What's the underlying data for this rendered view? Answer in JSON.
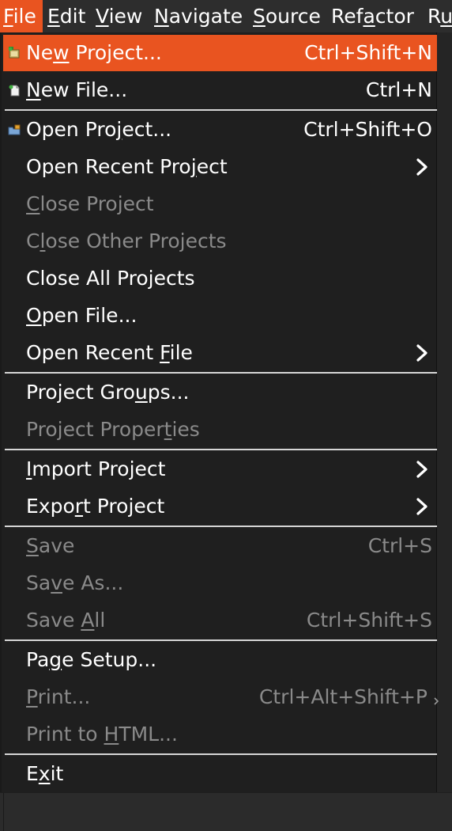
{
  "menubar": {
    "items": [
      {
        "label": "File",
        "mnemonic": 0,
        "active": true
      },
      {
        "label": "Edit",
        "mnemonic": 0
      },
      {
        "label": "View",
        "mnemonic": 0
      },
      {
        "label": "Navigate",
        "mnemonic": 0
      },
      {
        "label": "Source",
        "mnemonic": 0
      },
      {
        "label": "Refactor",
        "mnemonic": 3
      },
      {
        "label": "Ru",
        "mnemonic": 1
      }
    ]
  },
  "file_menu": {
    "items": [
      {
        "label": "New Project...",
        "mnemonic": 2,
        "shortcut": "Ctrl+Shift+N",
        "icon": "new-project-icon",
        "highlighted": true
      },
      {
        "label": "New File...",
        "mnemonic": 0,
        "shortcut": "Ctrl+N",
        "icon": "new-file-icon"
      },
      {
        "separator": true
      },
      {
        "label": "Open Project...",
        "mnemonic": 8,
        "shortcut": "Ctrl+Shift+O",
        "icon": "open-project-icon"
      },
      {
        "label": "Open Recent Project",
        "mnemonic": 15,
        "submenu": true
      },
      {
        "label": "Close Project",
        "mnemonic": 0,
        "disabled": true
      },
      {
        "label": "Close Other Projects",
        "mnemonic": 1,
        "disabled": true
      },
      {
        "label": "Close All Projects"
      },
      {
        "label": "Open File...",
        "mnemonic": 0
      },
      {
        "label": "Open Recent File",
        "mnemonic": 12,
        "submenu": true
      },
      {
        "separator": true
      },
      {
        "label": "Project Groups...",
        "mnemonic": 11
      },
      {
        "label": "Project Properties",
        "mnemonic": 14,
        "disabled": true
      },
      {
        "separator": true
      },
      {
        "label": "Import Project",
        "mnemonic": 0,
        "submenu": true
      },
      {
        "label": "Export Project",
        "mnemonic": 4,
        "submenu": true
      },
      {
        "separator": true
      },
      {
        "label": "Save",
        "mnemonic": 0,
        "shortcut": "Ctrl+S",
        "disabled": true
      },
      {
        "label": "Save As...",
        "mnemonic": 2,
        "disabled": true
      },
      {
        "label": "Save All",
        "mnemonic": 5,
        "shortcut": "Ctrl+Shift+S",
        "disabled": true
      },
      {
        "separator": true
      },
      {
        "label": "Page Setup...",
        "mnemonic": 2
      },
      {
        "label": "Print...",
        "mnemonic": 0,
        "shortcut": "Ctrl+Alt+Shift+P",
        "disabled": true,
        "clipped_arrow": true
      },
      {
        "label": "Print to HTML...",
        "mnemonic": 9,
        "disabled": true
      },
      {
        "separator": true
      },
      {
        "label": "Exit",
        "mnemonic": 1
      }
    ]
  },
  "colors": {
    "accent": "#e95420",
    "menu_bg": "#1f1f1f",
    "text": "#ffffff",
    "disabled_text": "#8a8a8a",
    "separator": "#d6d6d6"
  }
}
